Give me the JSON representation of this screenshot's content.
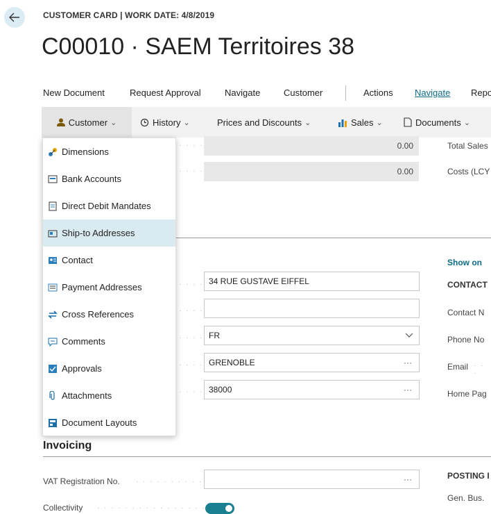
{
  "header": {
    "caption": "CUSTOMER CARD | WORK DATE: 4/8/2019",
    "title": "C00010 · SAEM Territoires 38"
  },
  "actionbar": {
    "items": [
      "New Document",
      "Request Approval",
      "Navigate",
      "Customer",
      "Actions",
      "Navigate",
      "Repo"
    ]
  },
  "subbar": {
    "customer": "Customer",
    "history": "History",
    "prices": "Prices and Discounts",
    "sales": "Sales",
    "documents": "Documents"
  },
  "menu": {
    "items": [
      "Dimensions",
      "Bank Accounts",
      "Direct Debit Mandates",
      "Ship-to Addresses",
      "Contact",
      "Payment Addresses",
      "Cross References",
      "Comments",
      "Approvals",
      "Attachments",
      "Document Layouts"
    ],
    "highlighted": "Ship-to Addresses"
  },
  "balances": {
    "value1": "0.00",
    "value2": "0.00",
    "right_label1": "Total Sales",
    "right_label2": "Costs (LCY"
  },
  "address": {
    "address": "34 RUE GUSTAVE EIFFEL",
    "address2": "",
    "country": "FR",
    "city": "GRENOBLE",
    "postcode": "38000",
    "right": {
      "show_on": "Show on",
      "contact_header": "CONTACT",
      "contact_name": "Contact N",
      "phone": "Phone No",
      "email": "Email",
      "home_page": "Home Pag"
    }
  },
  "invoicing": {
    "heading": "Invoicing",
    "vat_label": "VAT Registration No.",
    "vat_value": "",
    "collectivity_label": "Collectivity",
    "collectivity_on": true,
    "posting_header": "POSTING I",
    "gen_bus": "Gen. Bus."
  },
  "colors": {
    "accent": "#0b6a86",
    "toggle": "#1a7f91",
    "menu_highlight": "#d9eaf0"
  }
}
